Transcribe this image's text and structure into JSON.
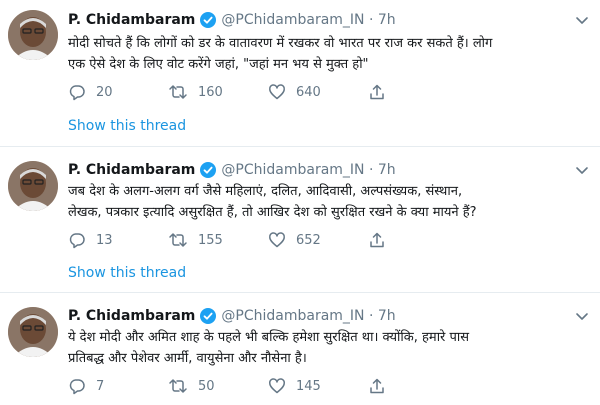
{
  "tweets": [
    {
      "name": "P. Chidambaram",
      "handle": "@PChidambaram_IN",
      "time": "7h",
      "lines": [
        "मोदी सोचते हैं कि लोगों को डर के वातावरण में रखकर वो भारत पर राज कर सकते हैं। लोग",
        "एक ऐसे देश के लिए वोट करेंगे जहां, \"जहां मन भय से मुक्त हो\""
      ],
      "replies": "20",
      "retweets": "160",
      "likes": "640",
      "show_thread": "Show this thread"
    },
    {
      "name": "P. Chidambaram",
      "handle": "@PChidambaram_IN",
      "time": "7h",
      "lines": [
        "जब देश के अलग-अलग वर्ग जैसे महिलाएं, दलित, आदिवासी, अल्पसंख्यक, संस्थान,",
        "लेखक, पत्रकार इत्यादि असुरक्षित हैं, तो आखिर देश को सुरक्षित रखने के क्या मायने हैं?"
      ],
      "replies": "13",
      "retweets": "155",
      "likes": "652",
      "show_thread": "Show this thread"
    },
    {
      "name": "P. Chidambaram",
      "handle": "@PChidambaram_IN",
      "time": "7h",
      "lines": [
        "ये देश मोदी और अमित शाह के पहले भी बल्कि हमेशा सुरक्षित था। क्योंकि, हमारे पास",
        "प्रतिबद्ध और पेशेवर आर्मी, वायुसेना और नौसेना है।"
      ],
      "replies": "7",
      "retweets": "50",
      "likes": "145"
    }
  ],
  "icons": {
    "reply": "reply-icon",
    "retweet": "retweet-icon",
    "like": "like-icon",
    "share": "share-icon",
    "verified": "verified-badge-icon",
    "caret": "chevron-down-icon"
  },
  "colors": {
    "link": "#1b95e0",
    "verified": "#1da1f2",
    "muted": "#657786",
    "text": "#14171a"
  }
}
